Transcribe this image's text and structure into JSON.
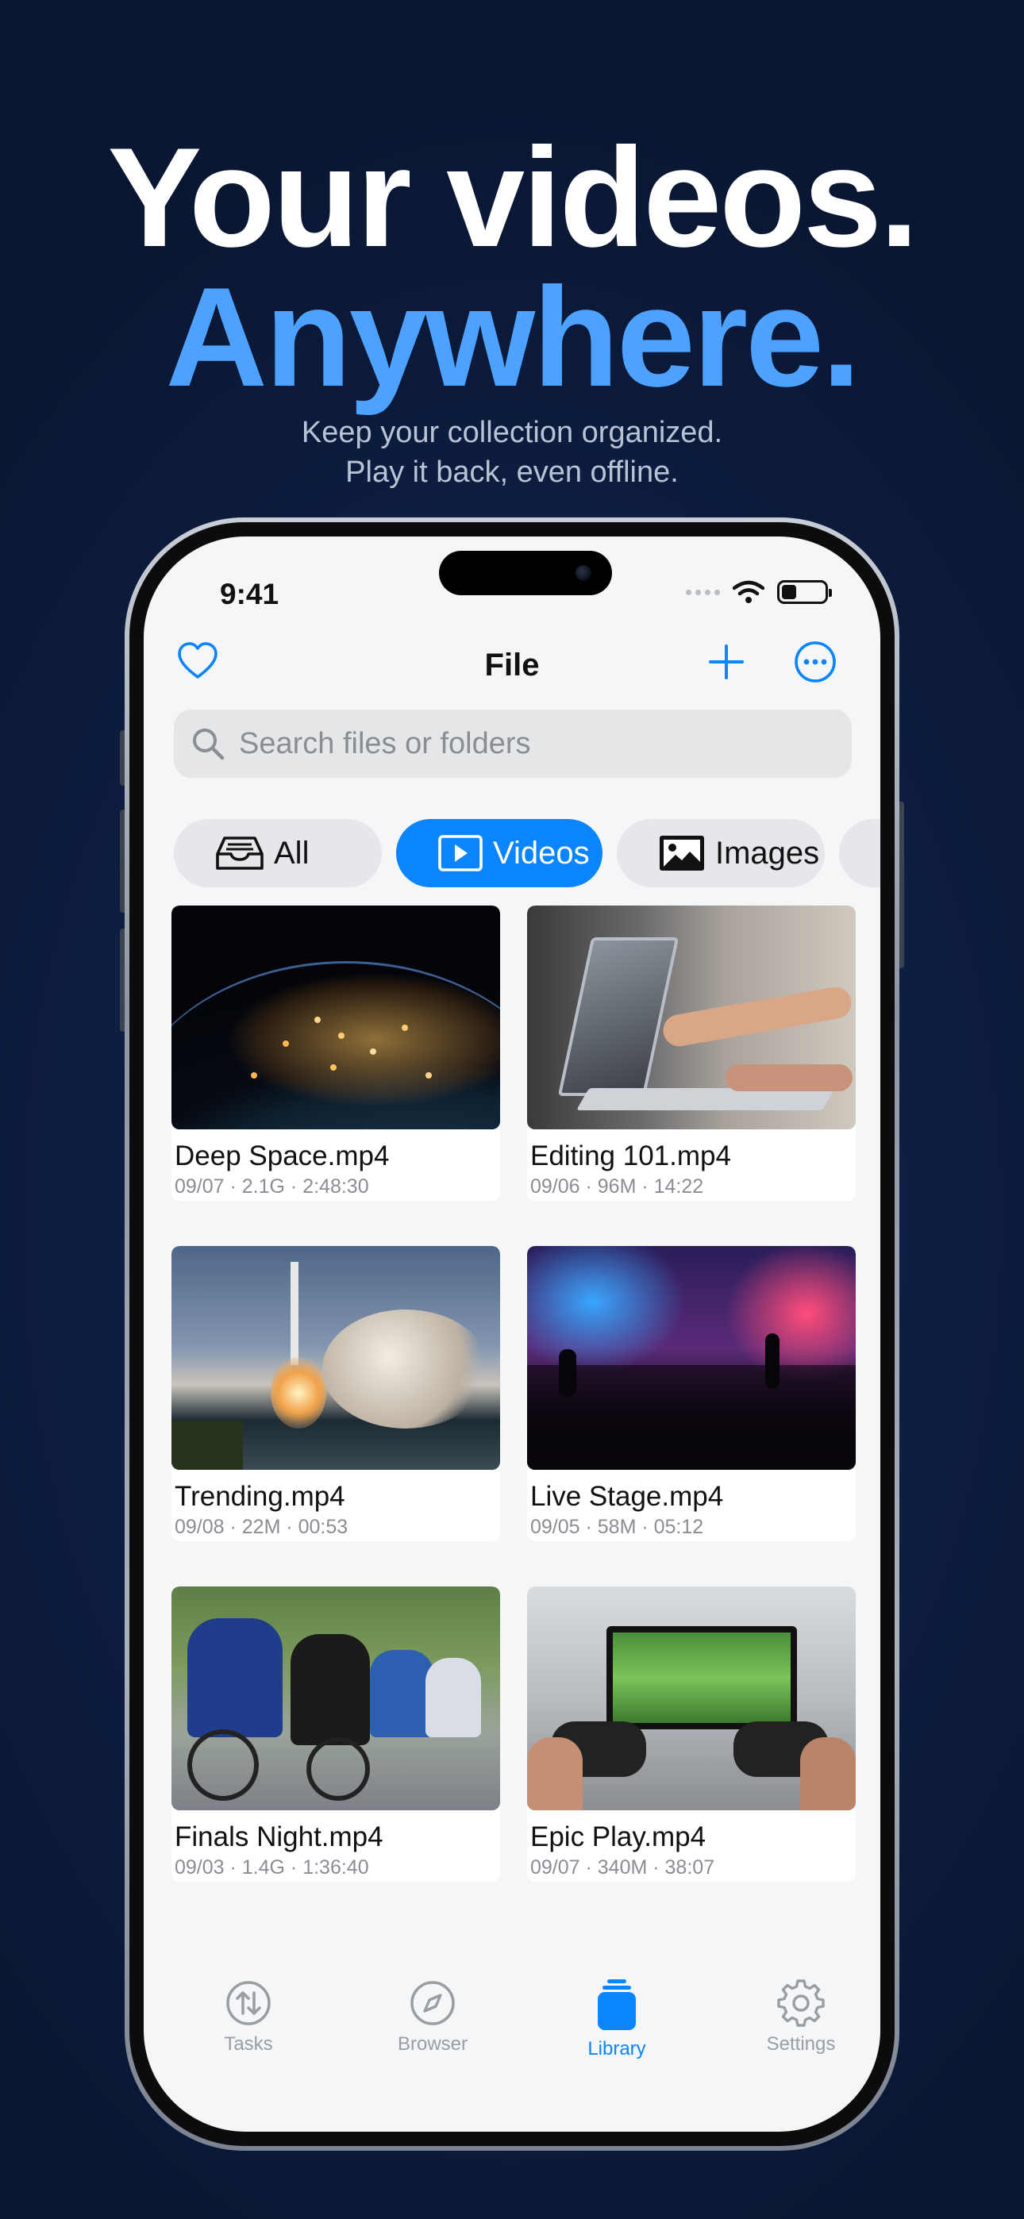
{
  "hero": {
    "line1": "Your videos.",
    "line2": "Anywhere.",
    "subtitle1": "Keep your collection organized.",
    "subtitle2": "Play it back, even offline."
  },
  "status_bar": {
    "time": "9:41"
  },
  "nav": {
    "title": "File",
    "left_icon": "heart-icon",
    "right_icons": [
      "plus-icon",
      "more-icon"
    ]
  },
  "search": {
    "placeholder": "Search files or folders"
  },
  "filters": [
    {
      "label": "All",
      "icon": "tray-icon",
      "active": false
    },
    {
      "label": "Videos",
      "icon": "play-rectangle-icon",
      "active": true
    },
    {
      "label": "Images",
      "icon": "photo-icon",
      "active": false
    }
  ],
  "files": [
    {
      "title": "Deep Space.mp4",
      "meta": "09/07 · 2.1G · 2:48:30",
      "thumbnail": "earth-night-lights"
    },
    {
      "title": "Editing 101.mp4",
      "meta": "09/06 · 96M · 14:22",
      "thumbnail": "laptop-hands"
    },
    {
      "title": "Trending.mp4",
      "meta": "09/08 · 22M · 00:53",
      "thumbnail": "rocket-launch"
    },
    {
      "title": "Live Stage.mp4",
      "meta": "09/05 · 58M · 05:12",
      "thumbnail": "concert-crowd"
    },
    {
      "title": "Finals Night.mp4",
      "meta": "09/03 · 1.4G · 1:36:40",
      "thumbnail": "cycling-race"
    },
    {
      "title": "Epic Play.mp4",
      "meta": "09/07 · 340M · 38:07",
      "thumbnail": "game-controllers"
    }
  ],
  "tabs": [
    {
      "label": "Tasks",
      "icon": "arrows-updown-icon",
      "active": false
    },
    {
      "label": "Browser",
      "icon": "compass-icon",
      "active": false
    },
    {
      "label": "Library",
      "icon": "library-icon",
      "active": true
    },
    {
      "label": "Settings",
      "icon": "gear-icon",
      "active": false
    }
  ],
  "colors": {
    "accent": "#0a84ff",
    "hero_accent": "#4ea2ff",
    "background": "#0f2047"
  }
}
